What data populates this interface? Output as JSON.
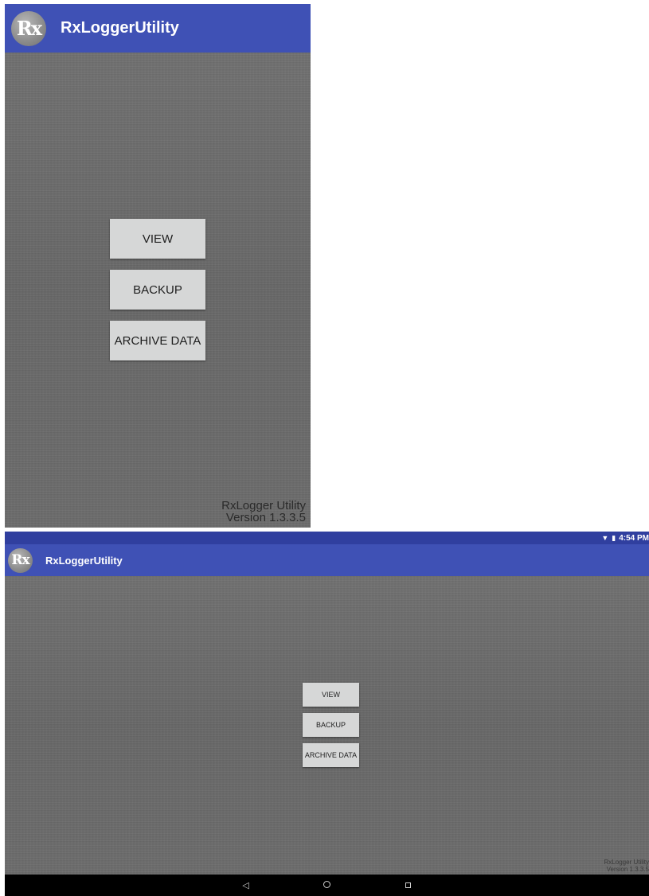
{
  "app": {
    "title": "RxLoggerUtility",
    "logo_text": "Rx",
    "icon": "rx-logo-icon",
    "accent_color": "#3f51b5"
  },
  "main": {
    "buttons": {
      "view": "VIEW",
      "backup": "BACKUP",
      "archive": "ARCHIVE DATA"
    },
    "version": {
      "line1": "RxLogger Utility",
      "line2": "Version 1.3.3.5"
    }
  },
  "landscape": {
    "status_bar": {
      "time": "4:54 PM",
      "icons": [
        "wifi-icon",
        "battery-icon"
      ]
    },
    "nav_bar": {
      "back": "◁",
      "home": "circle-icon",
      "recents": "square-icon"
    }
  }
}
